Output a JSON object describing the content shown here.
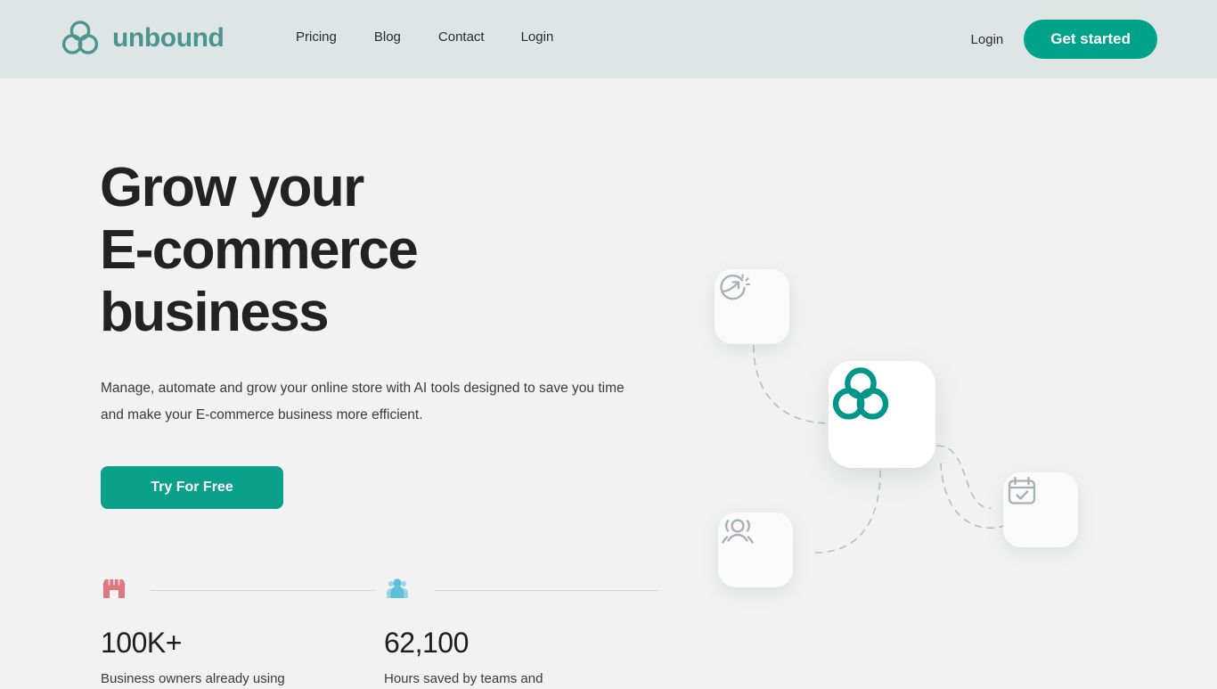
{
  "colors": {
    "header_bg": "#dde5e5",
    "page_bg": "#f2f2f2",
    "brand_teal": "#4b9490",
    "accent_green": "#00a38a",
    "cta_green": "#0aa08a",
    "heading": "#222222",
    "store_icon": "#e0777c",
    "people_icon": "#72c5da",
    "illustration_icon": "#a6b0b0"
  },
  "header": {
    "logo_icon": "trefoil-knot-logo-icon",
    "brand_name": "unbound",
    "nav": [
      {
        "label": "Pricing"
      },
      {
        "label": "Blog"
      },
      {
        "label": "Contact"
      },
      {
        "label": "Login"
      }
    ],
    "login_label": "Login",
    "cta_label": "Get started"
  },
  "hero": {
    "title": "Grow your\nE-commerce\nbusiness",
    "subtitle": "Manage, automate and grow your online store with AI tools designed to save you time and make your E-commerce business more efficient.",
    "cta_label": "Try For Free"
  },
  "stats": [
    {
      "icon": "storefront-icon",
      "value": "100K+",
      "label": "Business owners already using"
    },
    {
      "icon": "people-group-icon",
      "value": "62,100",
      "label": "Hours saved by teams and"
    }
  ],
  "illustration": {
    "cards": [
      {
        "icon": "growth-arrow-icon"
      },
      {
        "icon": "trefoil-knot-logo-icon"
      },
      {
        "icon": "users-icon"
      },
      {
        "icon": "calendar-check-icon"
      }
    ]
  }
}
